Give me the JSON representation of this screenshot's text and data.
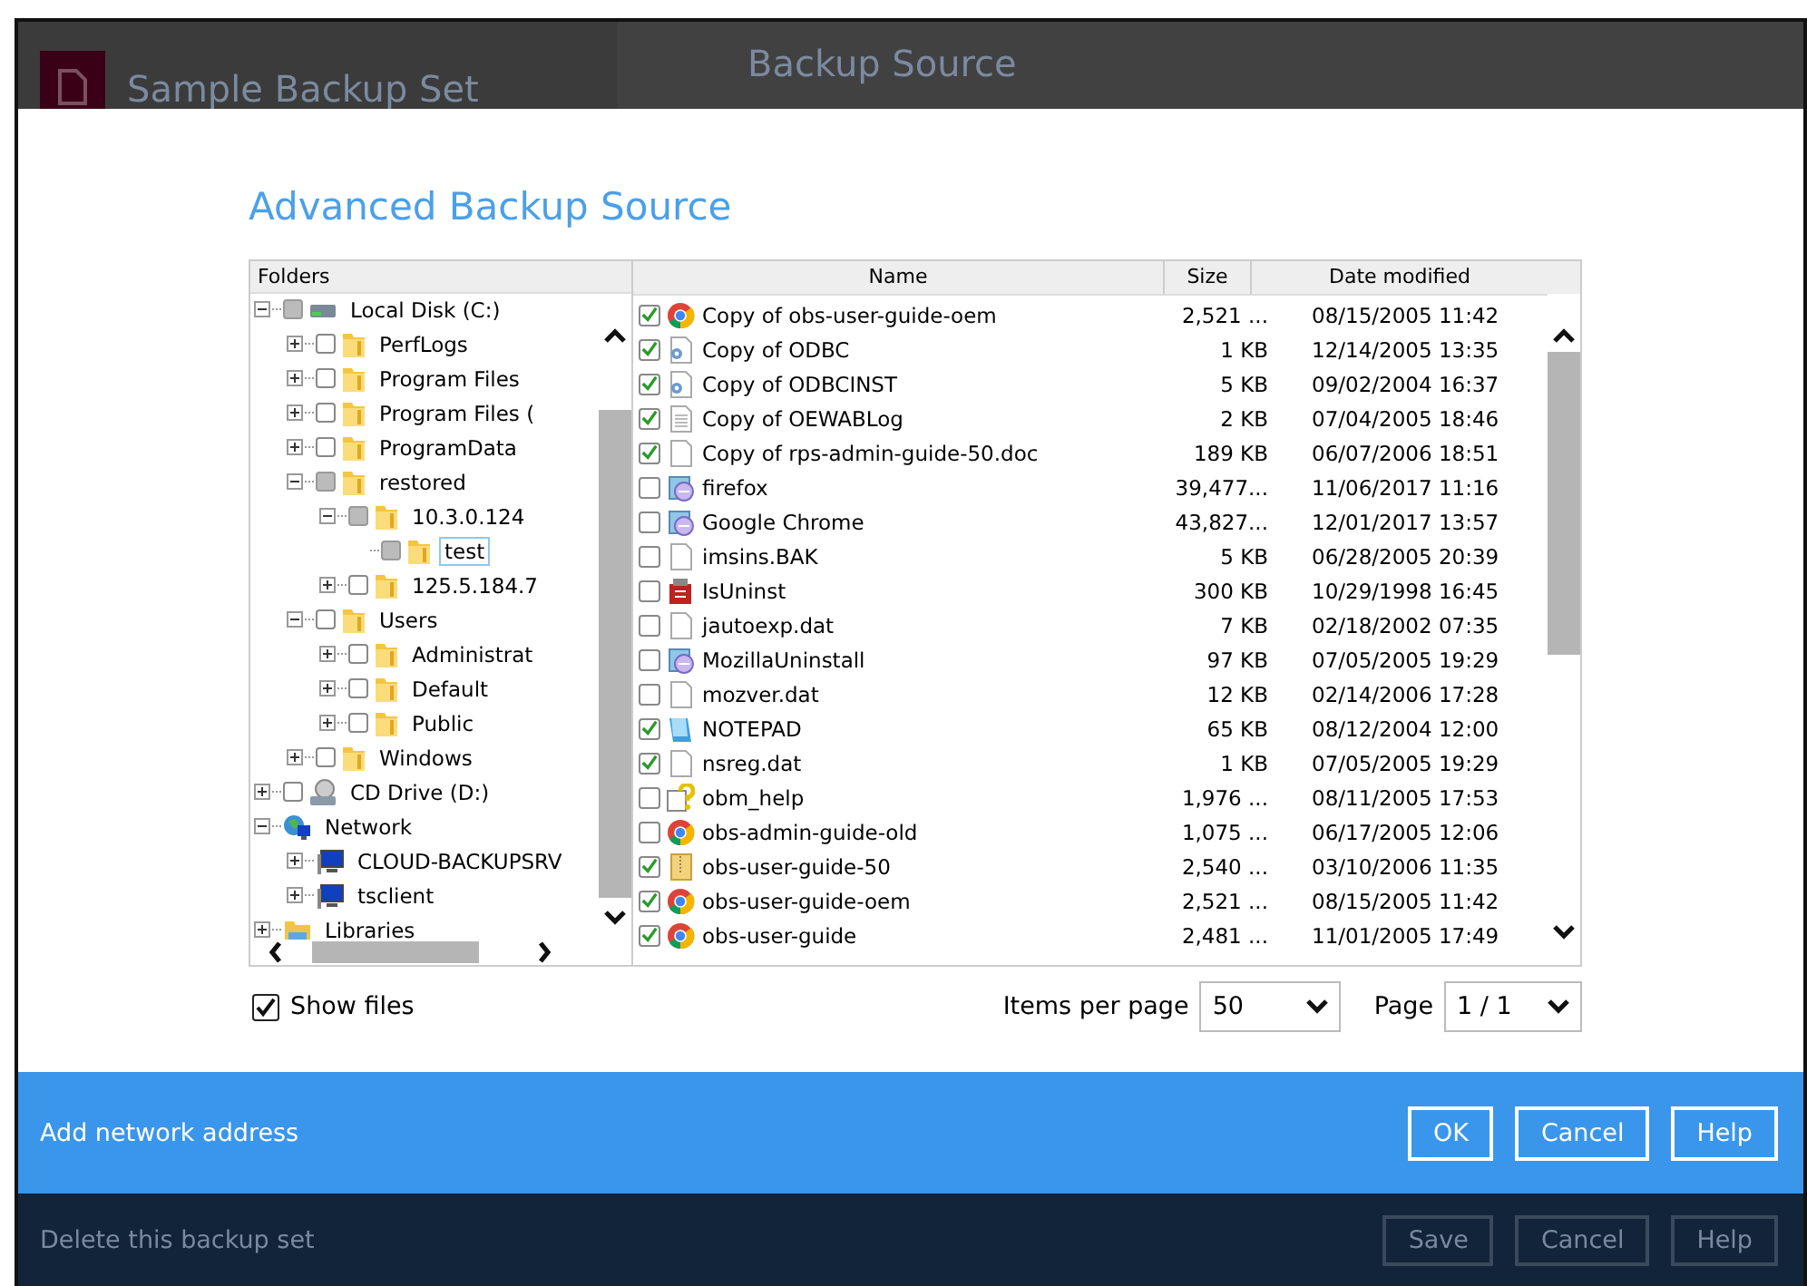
{
  "background": {
    "set_name": "Sample Backup Set",
    "page_title": "Backup Source",
    "footer_link": "Delete this backup set",
    "footer_buttons": [
      "Save",
      "Cancel",
      "Help"
    ]
  },
  "dialog": {
    "title": "Advanced Backup Source",
    "folders_header": "Folders",
    "tree": [
      {
        "label": "Local Disk (C:)",
        "kind": "drive",
        "expanded": true,
        "checked": false,
        "partial": true,
        "children": [
          {
            "label": "PerfLogs",
            "kind": "folder",
            "expanded": false,
            "checked": false,
            "partial": false
          },
          {
            "label": "Program Files",
            "kind": "folder",
            "expanded": false,
            "checked": false,
            "partial": false
          },
          {
            "label": "Program Files (",
            "kind": "folder",
            "expanded": false,
            "checked": false,
            "partial": false
          },
          {
            "label": "ProgramData",
            "kind": "folder",
            "expanded": false,
            "checked": false,
            "partial": false
          },
          {
            "label": "restored",
            "kind": "folder",
            "expanded": true,
            "checked": false,
            "partial": true,
            "children": [
              {
                "label": "10.3.0.124",
                "kind": "folder",
                "expanded": true,
                "checked": false,
                "partial": true,
                "children": [
                  {
                    "label": "test",
                    "kind": "folder",
                    "checked": false,
                    "partial": true,
                    "selected": true
                  }
                ]
              },
              {
                "label": "125.5.184.7",
                "kind": "folder",
                "expanded": false,
                "checked": false,
                "partial": false
              }
            ]
          },
          {
            "label": "Users",
            "kind": "folder",
            "expanded": true,
            "checked": false,
            "partial": false,
            "children": [
              {
                "label": "Administrat",
                "kind": "folder",
                "expanded": false,
                "checked": false,
                "partial": false
              },
              {
                "label": "Default",
                "kind": "folder",
                "expanded": false,
                "checked": false,
                "partial": false
              },
              {
                "label": "Public",
                "kind": "folder",
                "expanded": false,
                "checked": false,
                "partial": false
              }
            ]
          },
          {
            "label": "Windows",
            "kind": "folder",
            "expanded": false,
            "checked": false,
            "partial": false
          }
        ]
      },
      {
        "label": "CD Drive (D:)",
        "kind": "cdrom",
        "expanded": false,
        "checked": false,
        "partial": false
      },
      {
        "label": "Network",
        "kind": "network",
        "expanded": true,
        "children": [
          {
            "label": "CLOUD-BACKUPSRV",
            "kind": "computer",
            "expanded": false
          },
          {
            "label": "tsclient",
            "kind": "computer",
            "expanded": false
          }
        ]
      },
      {
        "label": "Libraries",
        "kind": "libraries",
        "expanded": false
      }
    ],
    "columns": [
      "Name",
      "Size",
      "Date modified"
    ],
    "files": [
      {
        "name": "Copy of obs-user-guide-oem",
        "kind": "chrome",
        "size": "2,521 ...",
        "date": "08/15/2005 11:42",
        "checked": true
      },
      {
        "name": "Copy of ODBC",
        "kind": "config",
        "size": "1 KB",
        "date": "12/14/2005 13:35",
        "checked": true
      },
      {
        "name": "Copy of ODBCINST",
        "kind": "config",
        "size": "5 KB",
        "date": "09/02/2004 16:37",
        "checked": true
      },
      {
        "name": "Copy of OEWABLog",
        "kind": "text",
        "size": "2 KB",
        "date": "07/04/2005 18:46",
        "checked": true
      },
      {
        "name": "Copy of rps-admin-guide-50.doc",
        "kind": "blank",
        "size": "189 KB",
        "date": "06/07/2006 18:51",
        "checked": true
      },
      {
        "name": "firefox",
        "kind": "setup",
        "size": "39,477...",
        "date": "11/06/2017 11:16",
        "checked": false
      },
      {
        "name": "Google Chrome",
        "kind": "setup",
        "size": "43,827...",
        "date": "12/01/2017 13:57",
        "checked": false
      },
      {
        "name": "imsins.BAK",
        "kind": "blank",
        "size": "5 KB",
        "date": "06/28/2005 20:39",
        "checked": false
      },
      {
        "name": "IsUninst",
        "kind": "uninstall",
        "size": "300 KB",
        "date": "10/29/1998 16:45",
        "checked": false
      },
      {
        "name": "jautoexp.dat",
        "kind": "blank",
        "size": "7 KB",
        "date": "02/18/2002 07:35",
        "checked": false
      },
      {
        "name": "MozillaUninstall",
        "kind": "setup",
        "size": "97 KB",
        "date": "07/05/2005 19:29",
        "checked": false
      },
      {
        "name": "mozver.dat",
        "kind": "blank",
        "size": "12 KB",
        "date": "02/14/2006 17:28",
        "checked": false
      },
      {
        "name": "NOTEPAD",
        "kind": "notepad",
        "size": "65 KB",
        "date": "08/12/2004 12:00",
        "checked": true
      },
      {
        "name": "nsreg.dat",
        "kind": "blank",
        "size": "1 KB",
        "date": "07/05/2005 19:29",
        "checked": true
      },
      {
        "name": "obm_help",
        "kind": "help",
        "size": "1,976 ...",
        "date": "08/11/2005 17:53",
        "checked": false
      },
      {
        "name": "obs-admin-guide-old",
        "kind": "chrome",
        "size": "1,075 ...",
        "date": "06/17/2005 12:06",
        "checked": false
      },
      {
        "name": "obs-user-guide-50",
        "kind": "zip",
        "size": "2,540 ...",
        "date": "03/10/2006 11:35",
        "checked": true
      },
      {
        "name": "obs-user-guide-oem",
        "kind": "chrome",
        "size": "2,521 ...",
        "date": "08/15/2005 11:42",
        "checked": true
      },
      {
        "name": "obs-user-guide",
        "kind": "chrome",
        "size": "2,481 ...",
        "date": "11/01/2005 17:49",
        "checked": true
      }
    ],
    "show_files": {
      "label": "Show files",
      "checked": true
    },
    "items_per_page": {
      "label": "Items per page",
      "value": "50"
    },
    "page": {
      "label": "Page",
      "value": "1 / 1"
    }
  },
  "action_bar": {
    "link": "Add network address",
    "buttons": [
      "OK",
      "Cancel",
      "Help"
    ]
  }
}
